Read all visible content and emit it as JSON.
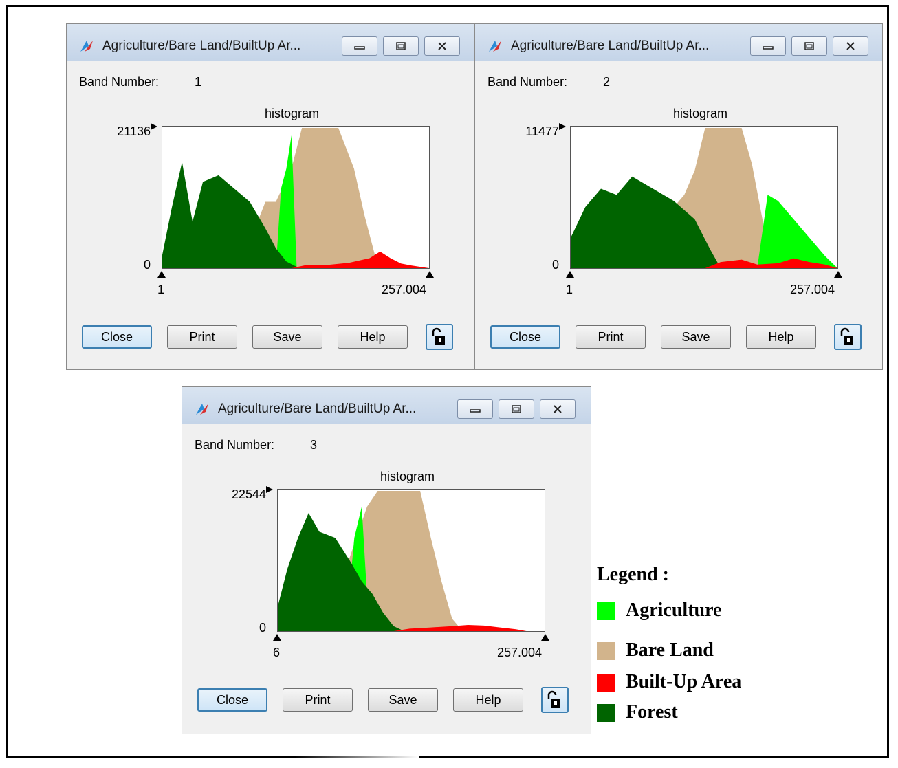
{
  "windows": [
    {
      "title": "Agriculture/Bare Land/BuiltUp Ar...",
      "band_label": "Band Number:",
      "band_value": "1",
      "hist_title": "histogram",
      "y_max": "21136",
      "y_min": "0",
      "x_min": "1",
      "x_max": "257.004",
      "buttons": {
        "close": "Close",
        "print": "Print",
        "save": "Save",
        "help": "Help"
      }
    },
    {
      "title": "Agriculture/Bare Land/BuiltUp Ar...",
      "band_label": "Band Number:",
      "band_value": "2",
      "hist_title": "histogram",
      "y_max": "11477",
      "y_min": "0",
      "x_min": "1",
      "x_max": "257.004",
      "buttons": {
        "close": "Close",
        "print": "Print",
        "save": "Save",
        "help": "Help"
      }
    },
    {
      "title": "Agriculture/Bare Land/BuiltUp Ar...",
      "band_label": "Band Number:",
      "band_value": "3",
      "hist_title": "histogram",
      "y_max": "22544",
      "y_min": "0",
      "x_min": "6",
      "x_max": "257.004",
      "buttons": {
        "close": "Close",
        "print": "Print",
        "save": "Save",
        "help": "Help"
      }
    }
  ],
  "legend": {
    "title": "Legend :",
    "items": [
      {
        "label": "Agriculture",
        "color": "#00ff00"
      },
      {
        "label": "Bare Land",
        "color": "#d2b48c"
      },
      {
        "label": "Built-Up Area",
        "color": "#ff0000"
      },
      {
        "label": "Forest",
        "color": "#006400"
      }
    ]
  },
  "chart_data": [
    {
      "type": "area",
      "title": "histogram",
      "xlim": [
        1,
        257.004
      ],
      "ylim": [
        0,
        21136
      ],
      "series": [
        {
          "name": "Forest",
          "color": "#006400",
          "x": [
            1,
            10,
            20,
            30,
            40,
            55,
            70,
            85,
            100,
            110,
            120,
            130,
            140
          ],
          "values": [
            2000,
            9000,
            16000,
            7000,
            13000,
            14000,
            12000,
            10000,
            6000,
            3000,
            1000,
            200,
            0
          ]
        },
        {
          "name": "Agriculture",
          "color": "#00ff00",
          "x": [
            110,
            115,
            120,
            125,
            130
          ],
          "values": [
            0,
            12000,
            15000,
            20000,
            0
          ]
        },
        {
          "name": "Bare Land",
          "color": "#d2b48c",
          "x": [
            90,
            100,
            110,
            125,
            135,
            150,
            170,
            185,
            195,
            205,
            215
          ],
          "values": [
            6000,
            10000,
            10000,
            15000,
            21136,
            21136,
            21136,
            15000,
            8000,
            2000,
            0
          ]
        },
        {
          "name": "Built-Up Area",
          "color": "#ff0000",
          "x": [
            125,
            140,
            160,
            180,
            200,
            210,
            220,
            230,
            240,
            257
          ],
          "values": [
            0,
            500,
            500,
            800,
            1500,
            2500,
            1500,
            700,
            400,
            0
          ]
        }
      ]
    },
    {
      "type": "area",
      "title": "histogram",
      "xlim": [
        1,
        257.004
      ],
      "ylim": [
        0,
        11477
      ],
      "series": [
        {
          "name": "Forest",
          "color": "#006400",
          "x": [
            1,
            15,
            30,
            45,
            60,
            80,
            100,
            120,
            135,
            145
          ],
          "values": [
            2500,
            5000,
            6500,
            6000,
            7500,
            6500,
            5500,
            4000,
            1500,
            0
          ]
        },
        {
          "name": "Agriculture",
          "color": "#00ff00",
          "x": [
            180,
            190,
            200,
            215,
            230,
            245,
            257
          ],
          "values": [
            0,
            6000,
            5500,
            4000,
            2500,
            1000,
            0
          ]
        },
        {
          "name": "Bare Land",
          "color": "#d2b48c",
          "x": [
            80,
            100,
            110,
            120,
            130,
            140,
            155,
            165,
            175,
            185,
            190
          ],
          "values": [
            3500,
            5000,
            6000,
            8000,
            11477,
            11477,
            11477,
            11477,
            8500,
            4000,
            0
          ]
        },
        {
          "name": "Built-Up Area",
          "color": "#ff0000",
          "x": [
            130,
            145,
            165,
            180,
            200,
            215,
            230,
            245,
            257
          ],
          "values": [
            0,
            500,
            700,
            300,
            400,
            800,
            500,
            300,
            0
          ]
        }
      ]
    },
    {
      "type": "area",
      "title": "histogram",
      "xlim": [
        6,
        257.004
      ],
      "ylim": [
        0,
        22544
      ],
      "series": [
        {
          "name": "Forest",
          "color": "#006400",
          "x": [
            6,
            15,
            25,
            35,
            45,
            60,
            75,
            85,
            95,
            105,
            115,
            125
          ],
          "values": [
            4000,
            10000,
            15000,
            19000,
            16000,
            15000,
            11000,
            8000,
            6000,
            3000,
            800,
            0
          ]
        },
        {
          "name": "Agriculture",
          "color": "#00ff00",
          "x": [
            70,
            78,
            85,
            92
          ],
          "values": [
            0,
            15000,
            20000,
            0
          ]
        },
        {
          "name": "Bare Land",
          "color": "#d2b48c",
          "x": [
            70,
            80,
            90,
            100,
            120,
            140,
            150,
            160,
            170,
            180
          ],
          "values": [
            10000,
            15000,
            20000,
            22544,
            22544,
            22544,
            15000,
            8000,
            2000,
            0
          ]
        },
        {
          "name": "Built-Up Area",
          "color": "#ff0000",
          "x": [
            115,
            130,
            150,
            170,
            185,
            200,
            215,
            230,
            240
          ],
          "values": [
            0,
            400,
            600,
            800,
            1000,
            900,
            600,
            300,
            0
          ]
        }
      ]
    }
  ]
}
